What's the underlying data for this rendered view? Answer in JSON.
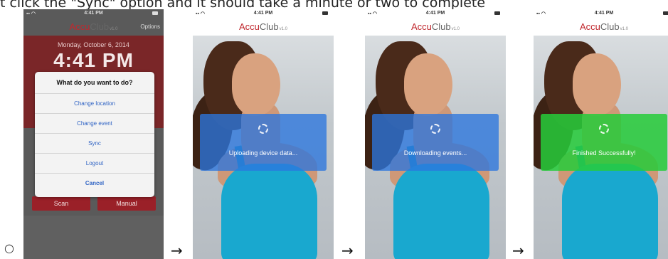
{
  "caption": "t click the \"Sync\" option and it should take a minute or two to complete",
  "bullet": "○",
  "arrow": "→",
  "brand": {
    "accu": "Accu",
    "club": "Club",
    "version": "v1.0"
  },
  "status_bar": {
    "time": "4:41 PM"
  },
  "screen1": {
    "options_label": "Options",
    "date": "Monday, October 6, 2014",
    "time": "4:41 PM",
    "dialog": {
      "title": "What do you want to do?",
      "items": [
        "Change location",
        "Change event",
        "Sync",
        "Logout",
        "Cancel"
      ]
    },
    "scan_label": "Scan",
    "manual_label": "Manual"
  },
  "screen2": {
    "status": "Uploading device data..."
  },
  "screen3": {
    "status": "Downloading events..."
  },
  "screen4": {
    "status": "Finished Successfully!"
  },
  "colors": {
    "brand_red": "#c0282e",
    "progress_blue": "#2c76de",
    "success_green": "#26cc3a",
    "link_blue": "#2f63c4"
  }
}
